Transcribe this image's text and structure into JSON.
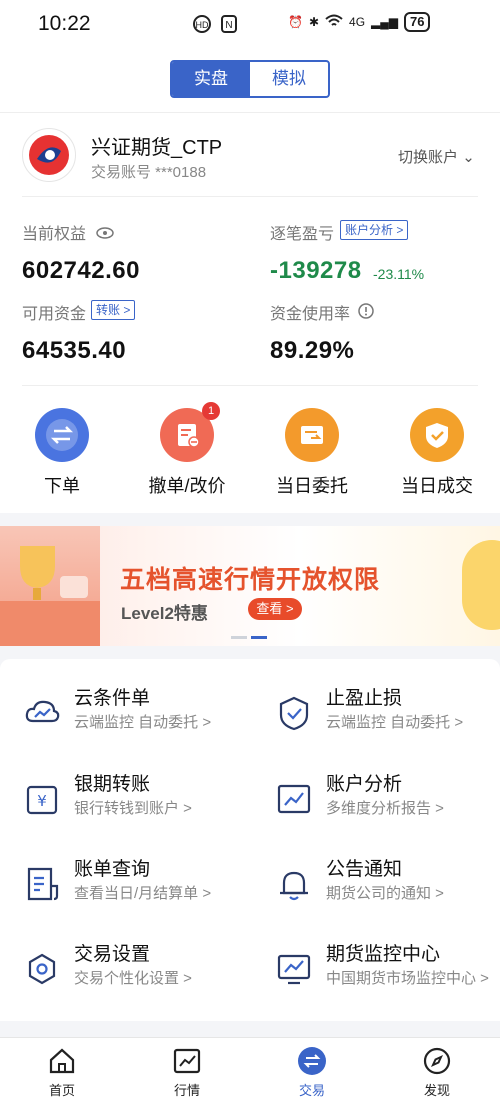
{
  "status_bar": {
    "time": "10:22",
    "battery": "76",
    "network": "4G"
  },
  "mode_tabs": [
    {
      "label": "实盘",
      "active": true
    },
    {
      "label": "模拟",
      "active": false
    }
  ],
  "account": {
    "name": "兴证期货_CTP",
    "number": "交易账号 ***0188",
    "switch_label": "切换账户"
  },
  "metrics": {
    "equity_label": "当前权益",
    "equity_value": "602742.60",
    "pnl_label": "逐笔盈亏",
    "pnl_button": "账户分析 >",
    "pnl_value": "-139278",
    "pnl_pct": "-23.11%",
    "available_label": "可用资金",
    "available_button": "转账 >",
    "available_value": "64535.40",
    "usage_label": "资金使用率",
    "usage_value": "89.29%"
  },
  "quick_actions": [
    {
      "label": "下单",
      "icon": "swap-icon",
      "color": "#4a74e0"
    },
    {
      "label": "撤单/改价",
      "icon": "cancel-order-icon",
      "color": "#f06a55",
      "badge": "1"
    },
    {
      "label": "当日委托",
      "icon": "entrust-icon",
      "color": "#f39a2c"
    },
    {
      "label": "当日成交",
      "icon": "deal-icon",
      "color": "#f3a12b"
    }
  ],
  "banner": {
    "title": "五档高速行情开放权限",
    "subtitle": "Level2特惠",
    "button": "查看 >"
  },
  "services": [
    {
      "title": "云条件单",
      "subtitle": "云端监控 自动委托 >"
    },
    {
      "title": "止盈止损",
      "subtitle": "云端监控 自动委托 >"
    },
    {
      "title": "银期转账",
      "subtitle": "银行转钱到账户 >"
    },
    {
      "title": "账户分析",
      "subtitle": "多维度分析报告 >"
    },
    {
      "title": "账单查询",
      "subtitle": "查看当日/月结算单 >"
    },
    {
      "title": "公告通知",
      "subtitle": "期货公司的通知 >"
    },
    {
      "title": "交易设置",
      "subtitle": "交易个性化设置 >"
    },
    {
      "title": "期货监控中心",
      "subtitle": "中国期货市场监控中心 >"
    }
  ],
  "bottom_nav": [
    {
      "label": "首页",
      "active": false
    },
    {
      "label": "行情",
      "active": false
    },
    {
      "label": "交易",
      "active": true
    },
    {
      "label": "发现",
      "active": false
    }
  ]
}
